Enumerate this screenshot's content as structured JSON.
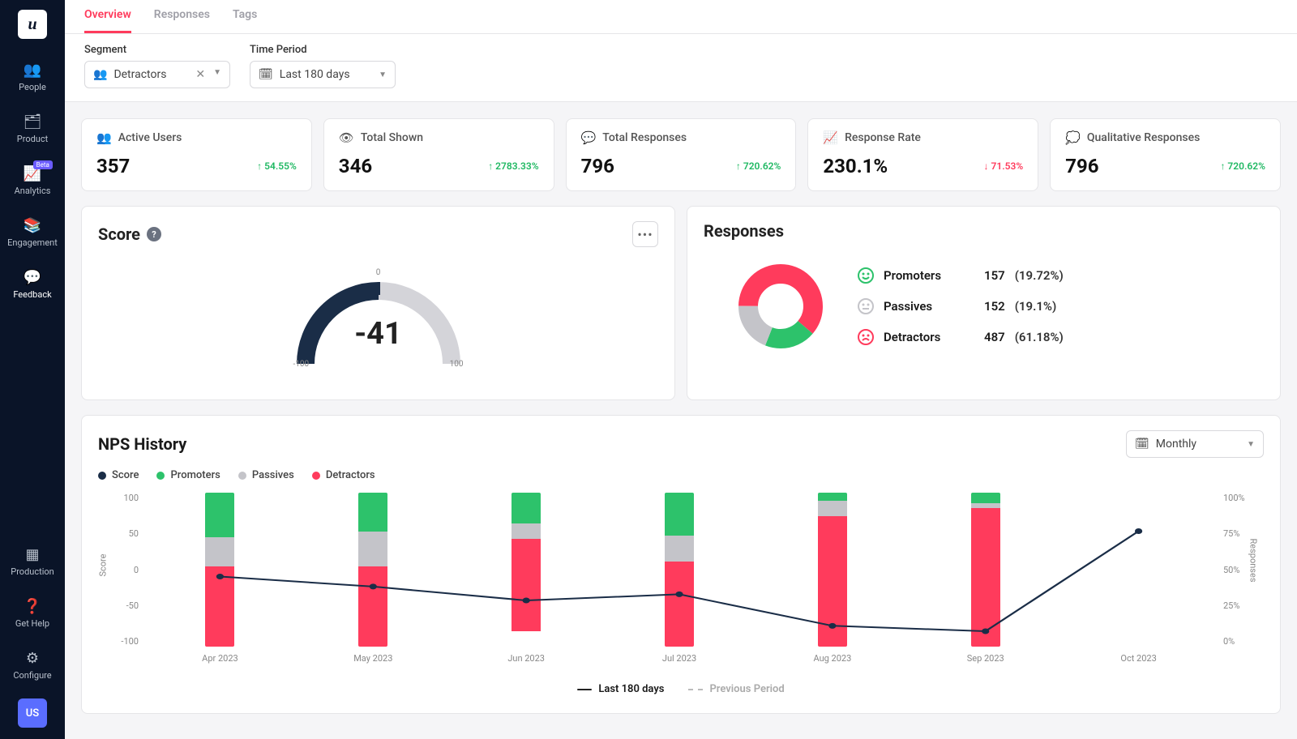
{
  "tabs": {
    "overview": "Overview",
    "responses": "Responses",
    "tags": "Tags"
  },
  "filters": {
    "segment_label": "Segment",
    "segment_value": "Detractors",
    "period_label": "Time Period",
    "period_value": "Last 180 days"
  },
  "stats": [
    {
      "icon": "👥",
      "label": "Active Users",
      "value": "357",
      "delta": "54.55%",
      "dir": "up"
    },
    {
      "icon": "👁",
      "label": "Total Shown",
      "value": "346",
      "delta": "2783.33%",
      "dir": "up"
    },
    {
      "icon": "💬",
      "label": "Total Responses",
      "value": "796",
      "delta": "720.62%",
      "dir": "up"
    },
    {
      "icon": "📈",
      "label": "Response Rate",
      "value": "230.1%",
      "delta": "71.53%",
      "dir": "down"
    },
    {
      "icon": "💭",
      "label": "Qualitative Responses",
      "value": "796",
      "delta": "720.62%",
      "dir": "up"
    }
  ],
  "score": {
    "title": "Score",
    "value": "-41",
    "min": "-100",
    "max": "100",
    "zero": "0"
  },
  "responses": {
    "title": "Responses",
    "items": [
      {
        "label": "Promoters",
        "count": "157",
        "pct": "(19.72%)",
        "color": "#2dc26b",
        "face": "smile"
      },
      {
        "label": "Passives",
        "count": "152",
        "pct": "(19.1%)",
        "color": "#c4c4c9",
        "face": "neutral"
      },
      {
        "label": "Detractors",
        "count": "487",
        "pct": "(61.18%)",
        "color": "#ff3b5c",
        "face": "frown"
      }
    ]
  },
  "history": {
    "title": "NPS History",
    "period_select": "Monthly",
    "legend": {
      "score": "Score",
      "prom": "Promoters",
      "pass": "Passives",
      "detr": "Detractors"
    },
    "y_left": [
      "100",
      "50",
      "0",
      "-50",
      "-100"
    ],
    "y_left_label": "Score",
    "y_right": [
      "100%",
      "75%",
      "50%",
      "25%",
      "0%"
    ],
    "y_right_label": "Responses",
    "bottom_legend": {
      "current": "Last 180 days",
      "previous": "Previous Period"
    }
  },
  "sidebar": {
    "items": [
      {
        "label": "People"
      },
      {
        "label": "Product"
      },
      {
        "label": "Analytics",
        "beta": "Beta"
      },
      {
        "label": "Engagement"
      },
      {
        "label": "Feedback",
        "active": true
      }
    ],
    "bottom": [
      {
        "label": "Production"
      },
      {
        "label": "Get Help"
      },
      {
        "label": "Configure"
      }
    ],
    "avatar": "US"
  },
  "chart_data": {
    "type": "bar+line",
    "categories": [
      "Apr 2023",
      "May 2023",
      "Jun 2023",
      "Jul 2023",
      "Aug 2023",
      "Sep 2023",
      "Oct 2023"
    ],
    "series": [
      {
        "name": "Score",
        "type": "line",
        "axis": "left",
        "values": [
          -9,
          -22,
          -40,
          -32,
          -73,
          -80,
          50
        ]
      },
      {
        "name": "Promoters",
        "type": "bar-stack",
        "axis": "right",
        "values": [
          29,
          25,
          20,
          28,
          5,
          7,
          0
        ]
      },
      {
        "name": "Passives",
        "type": "bar-stack",
        "axis": "right",
        "values": [
          19,
          23,
          10,
          17,
          10,
          3,
          0
        ]
      },
      {
        "name": "Detractors",
        "type": "bar-stack",
        "axis": "right",
        "values": [
          52,
          52,
          60,
          55,
          85,
          90,
          0
        ]
      }
    ],
    "title": "NPS History",
    "xlabel": "",
    "y_left_label": "Score",
    "y_left_range": [
      -100,
      100
    ],
    "y_right_label": "Responses",
    "y_right_range": [
      0,
      100
    ]
  }
}
